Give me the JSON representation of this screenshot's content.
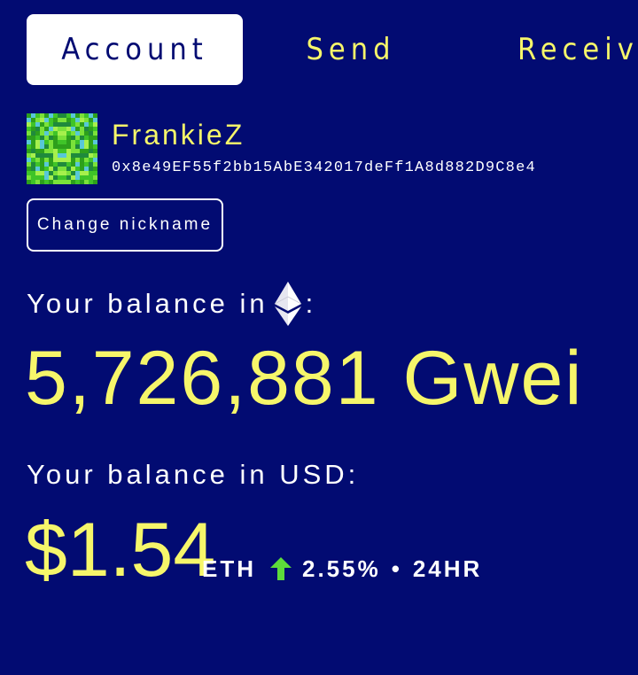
{
  "tabs": {
    "account": "Account",
    "send": "Send",
    "receive": "Receive",
    "active": "account"
  },
  "profile": {
    "nickname": "FrankieZ",
    "address": "0x8e49EF55f2bb15AbE342017deFf1A8d882D9C8e4",
    "avatar": "identicon-green"
  },
  "actions": {
    "change_nickname": "Change nickname"
  },
  "balance": {
    "eth_label_prefix": "Your balance in",
    "eth_label_suffix": ":",
    "eth_icon": "ethereum-icon",
    "gwei_value": "5,726,881 Gwei",
    "usd_label": "Your balance in USD:",
    "usd_value": "$1.54"
  },
  "ticker": {
    "symbol": "ETH",
    "trend_icon": "arrow-up-icon",
    "change": "2.55%",
    "separator": "•",
    "period": "24HR"
  },
  "colors": {
    "background": "#020b72",
    "accent": "#f6f66a",
    "text": "#ffffff",
    "up": "#5ddb3a"
  }
}
